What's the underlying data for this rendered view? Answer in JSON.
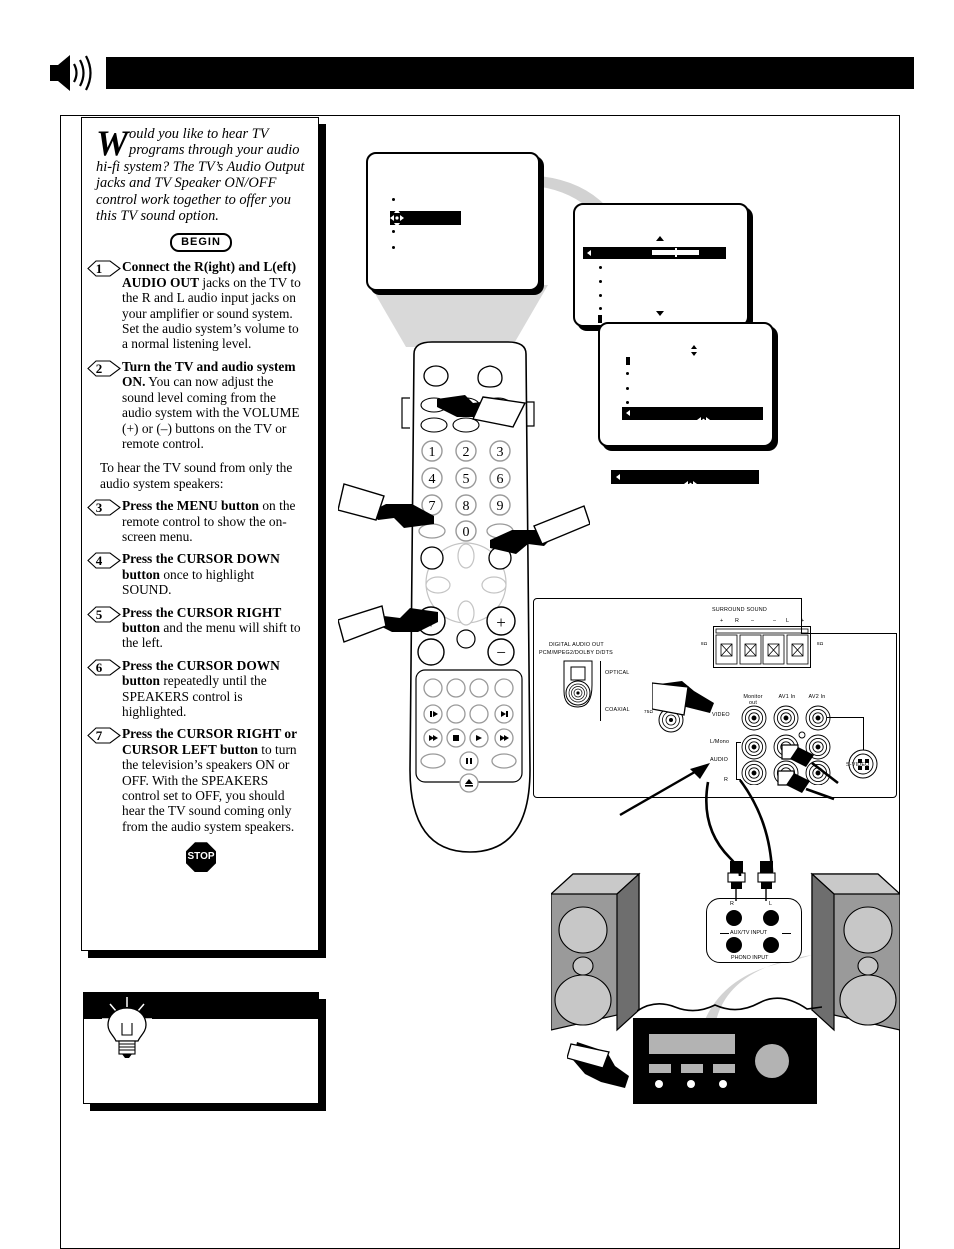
{
  "document": {
    "type": "tv-owners-manual-page",
    "header": {
      "title": "",
      "icon": "speaker-sound-icon",
      "bar_color": "#000000"
    }
  },
  "instructions": {
    "intro": {
      "dropcap": "W",
      "text": "ould you like to hear TV programs through your audio hi-fi system?  The TV’s Audio Output jacks and TV Speaker ON/OFF control work together to offer you this TV sound option."
    },
    "begin_label": "BEGIN",
    "stop_label": "STOP",
    "steps": [
      {
        "number": "1",
        "bold": "Connect the R(ight) and L(eft) AUDIO OUT",
        "rest": " jacks on the TV to the R and L audio input jacks on your amplifier or sound system.  Set the audio system’s volume to a normal listening level."
      },
      {
        "number": "2",
        "bold": "Turn the TV and audio system ON.",
        "rest": "  You can now adjust the sound level coming from the audio system with the VOLUME (+) or (–) buttons on the TV or remote control."
      },
      {
        "number": "3",
        "bold": "Press the MENU button",
        "rest": " on the remote control to show the on-screen menu."
      },
      {
        "number": "4",
        "bold": "Press the CURSOR DOWN button",
        "rest": " once to highlight SOUND."
      },
      {
        "number": "5",
        "bold": "Press the CURSOR RIGHT button",
        "rest": " and the menu will shift to the left."
      },
      {
        "number": "6",
        "bold": "Press the CURSOR DOWN button",
        "rest": " repeatedly until the SPEAKERS control is highlighted."
      },
      {
        "number": "7",
        "bold": "Press the CURSOR RIGHT or CURSOR LEFT button",
        "rest": " to turn the television’s speakers ON or OFF. With the SPEAKERS control set to OFF, you should hear the TV sound coming only from the audio system speakers."
      }
    ],
    "interstitial": "To hear the TV sound from only the audio system speakers:"
  },
  "tip_box": {
    "icon": "lightbulb-icon",
    "heading": "",
    "body": ""
  },
  "tv_menus": {
    "screen1": {
      "name": "main-menu",
      "items": [
        "",
        "",
        "",
        ""
      ],
      "highlighted_index": 1,
      "cursor_glyphs": [
        "up-arrow",
        "left-arrow",
        "right-arrow",
        "down-arrow"
      ]
    },
    "screen2": {
      "name": "sound-menu-shifted",
      "highlighted_index": 0,
      "has_slider": true,
      "slider_value": 55,
      "items": [
        "",
        "",
        "",
        "",
        "",
        ""
      ],
      "scroll_up_glyph": "up-triangle",
      "scroll_down_glyph": "down-triangle"
    },
    "screen3": {
      "name": "speakers-control",
      "highlighted_index": 5,
      "items": [
        "",
        "",
        "",
        "",
        "",
        ""
      ],
      "cursor_glyphs": [
        "left-arrow",
        "left-right-arrows"
      ],
      "scroll_up_glyph": "up-down-arrow"
    },
    "strip": {
      "name": "speakers-highlight-strip",
      "left_glyph": "left-arrow",
      "center_glyph": "left-right-arrows"
    }
  },
  "remote": {
    "name": "tv-remote-control",
    "keypad": [
      "1",
      "2",
      "3",
      "4",
      "5",
      "6",
      "7",
      "8",
      "9",
      "0"
    ],
    "volume_plus": "+",
    "volume_minus": "−",
    "channel_plus": "+",
    "transport_glyphs": [
      "⏮",
      "⏭",
      "⏪",
      "■",
      "▶",
      "⏩",
      "⏸",
      "⏏"
    ]
  },
  "rear_panel": {
    "name": "tv-rear-connection-panel",
    "surround": {
      "title": "SURROUND SOUND",
      "marks": [
        "+",
        "R",
        "–",
        "–",
        "L",
        "+"
      ],
      "impedance_left": "8Ω",
      "impedance_right": "8Ω"
    },
    "digital_out": {
      "line1": "DIGITAL AUDIO OUT",
      "line2": "PCM/MPEG2/DOLBY D/DTS",
      "optical": "OPTICAL",
      "coaxial": "COAXIAL"
    },
    "antenna": "75Ω",
    "jack_columns": [
      "Monitor out",
      "AV1 In",
      "AV2 In"
    ],
    "jack_rows": [
      "VIDEO",
      "L/Mono",
      "R"
    ],
    "audio_group": "AUDIO",
    "svideo": "S-VIDEO"
  },
  "audio_system": {
    "name": "stereo-hi-fi-system",
    "amp_inputs": {
      "aux_tv": "AUX/TV INPUT",
      "phono": "PHONO INPUT",
      "right_label": "R",
      "left_label": "L"
    },
    "speakers": [
      "left-speaker",
      "right-speaker"
    ],
    "receiver": "stereo-receiver"
  },
  "colors": {
    "ink": "#000000",
    "paper": "#ffffff",
    "speaker_front": "#9a9a9a",
    "speaker_side": "#6e6e6e",
    "speaker_top": "#c9c9c9",
    "cone": "#c7c7c7",
    "swoosh": "#d2d2d2",
    "receiver_body": "#000000",
    "receiver_display": "#b3b3b3"
  }
}
